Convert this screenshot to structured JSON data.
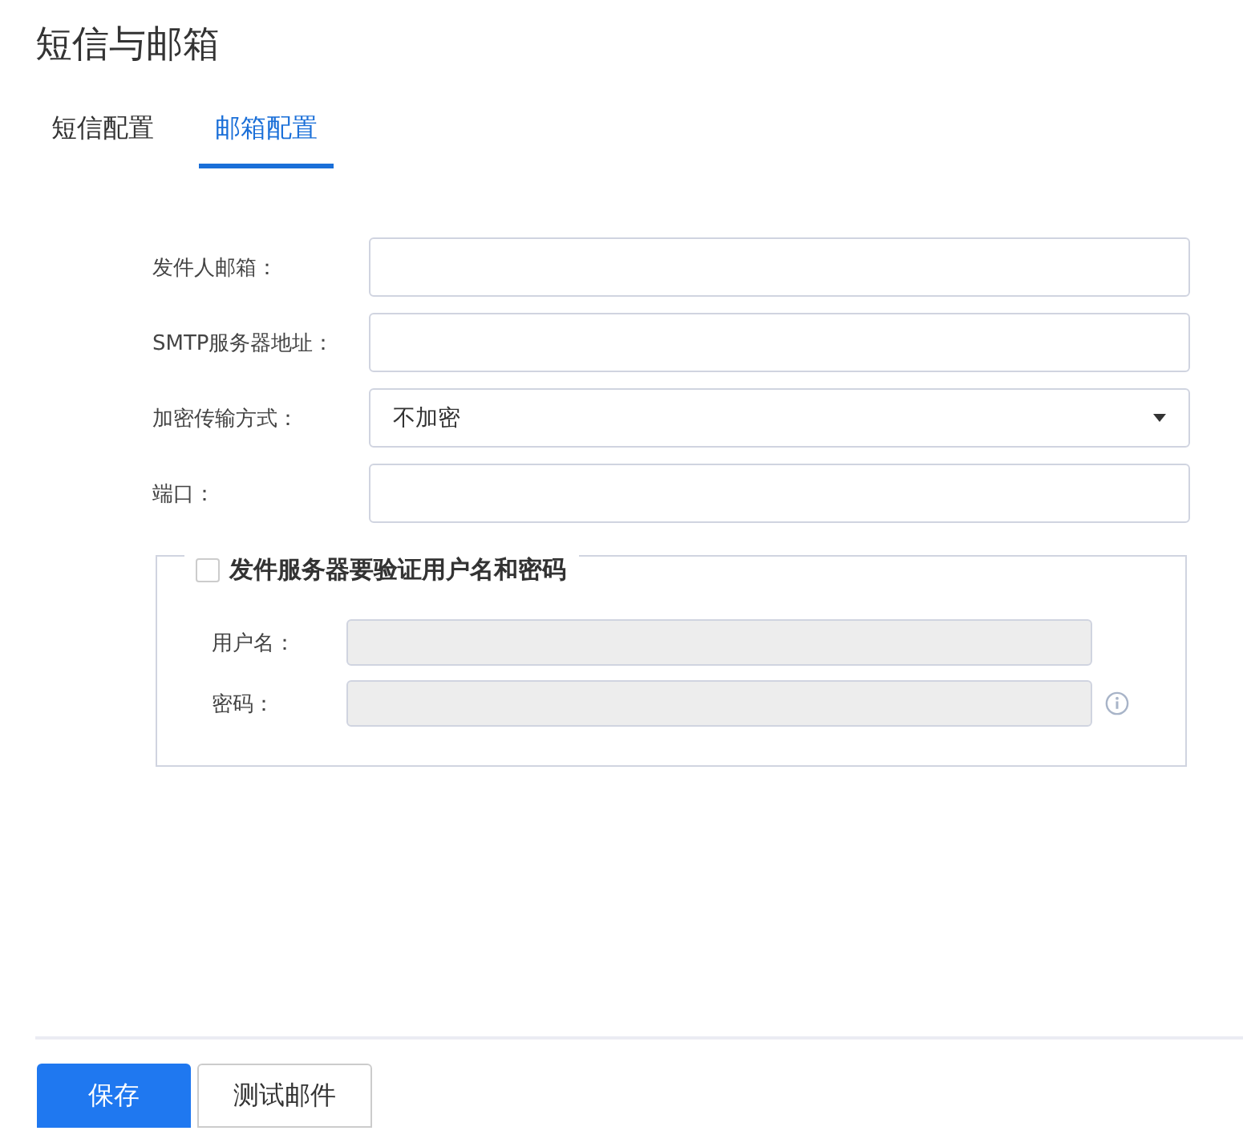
{
  "page_title": "短信与邮箱",
  "tabs": [
    {
      "label": "短信配置",
      "selected": false
    },
    {
      "label": "邮箱配置",
      "selected": true
    }
  ],
  "fields": [
    {
      "kind": "text",
      "label": "发件人邮箱："
    },
    {
      "kind": "text",
      "label": "SMTP服务器地址："
    },
    {
      "kind": "select",
      "label": "加密传输方式：",
      "value": "不加密"
    },
    {
      "kind": "text",
      "label": "端口："
    }
  ],
  "auth": {
    "label": "发件服务器要验证用户名和密码",
    "checked": false,
    "fields": [
      {
        "label": "用户名：",
        "disabled": true,
        "info": false
      },
      {
        "label": "密码：",
        "disabled": true,
        "info": true
      }
    ]
  },
  "buttons": [
    {
      "label": "保存",
      "kind": "primary"
    },
    {
      "label": "测试邮件",
      "kind": "default"
    }
  ]
}
